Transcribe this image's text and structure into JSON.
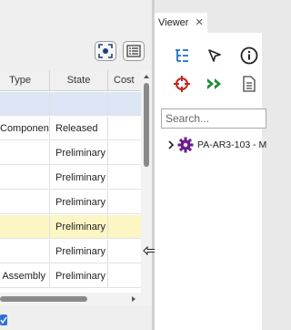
{
  "left_panel": {
    "table": {
      "columns": [
        "Type",
        "State",
        "Cost"
      ],
      "rows": [
        {
          "type": "",
          "state": "",
          "highlight": "blue"
        },
        {
          "type": "Component",
          "state": "Released",
          "highlight": "none"
        },
        {
          "type": "",
          "state": "Preliminary",
          "highlight": "none"
        },
        {
          "type": "",
          "state": "Preliminary",
          "highlight": "none"
        },
        {
          "type": "",
          "state": "Preliminary",
          "highlight": "none"
        },
        {
          "type": "",
          "state": "Preliminary",
          "highlight": "yellow"
        },
        {
          "type": "",
          "state": "Preliminary",
          "highlight": "none"
        },
        {
          "type": "Assembly",
          "state": "Preliminary",
          "highlight": "none"
        }
      ]
    },
    "toolbar_icons": [
      "focus-icon",
      "list-view-icon"
    ],
    "checkbox_checked": true
  },
  "viewer": {
    "tab_label": "Viewer",
    "close_glyph": "✕",
    "tools": [
      "tree-view-icon",
      "pointer-icon",
      "info-icon",
      "target-icon",
      "forward-icon",
      "document-icon"
    ],
    "search_placeholder": "Search...",
    "tree_item": {
      "label": "PA-AR3-103 - M",
      "icon": "gear-icon"
    }
  },
  "colors": {
    "selected_row_blue": "#dce6f4",
    "highlight_row_yellow": "#fbf6c4",
    "accent_blue": "#1e6fd0",
    "purple": "#6b1d8f",
    "green": "#1e8b3a",
    "red": "#c0281c"
  }
}
